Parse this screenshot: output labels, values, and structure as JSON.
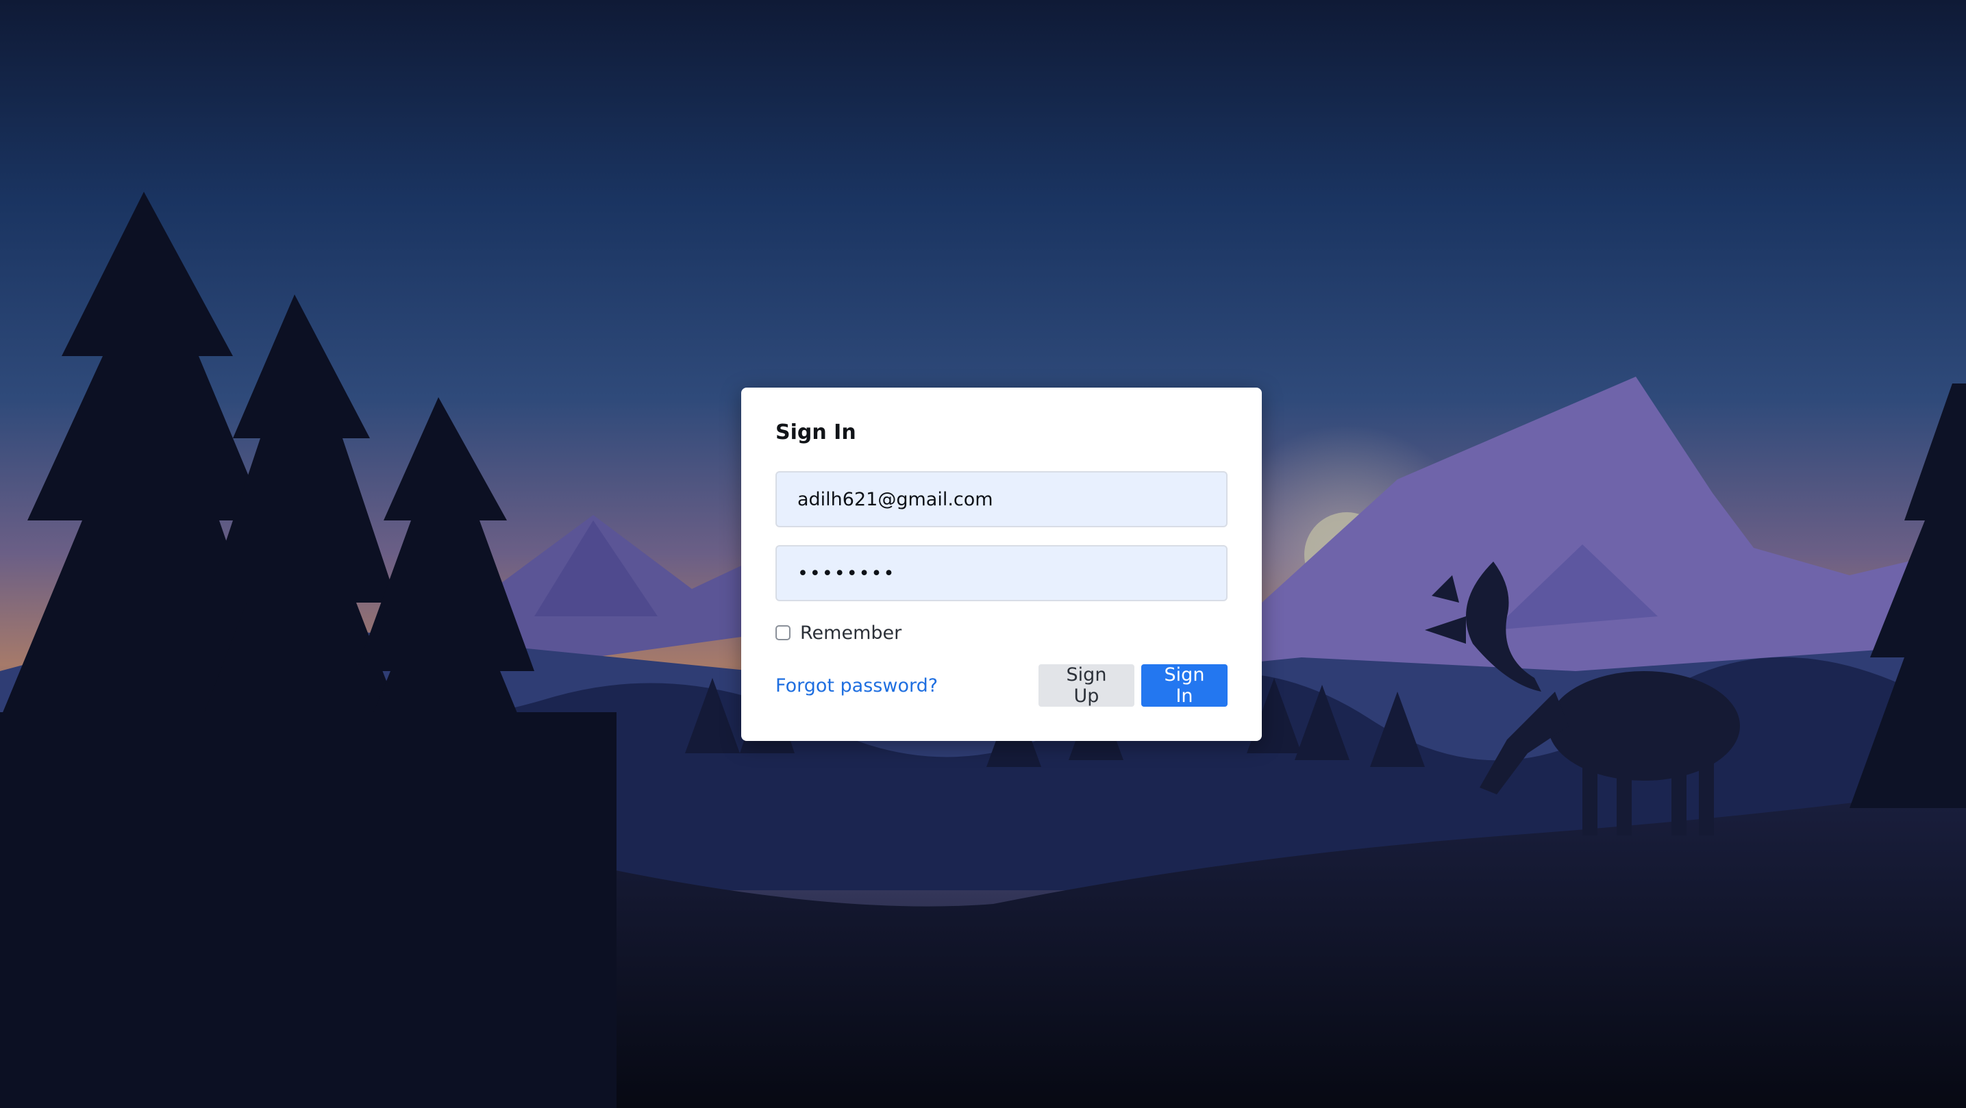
{
  "form": {
    "title": "Sign In",
    "email_value": "adilh621@gmail.com",
    "password_value": "••••••••",
    "remember_label": "Remember",
    "remember_checked": false,
    "forgot_label": "Forgot password?",
    "signup_label": "Sign Up",
    "signin_label": "Sign In"
  },
  "colors": {
    "accent": "#2377f0",
    "link": "#1f6fe0",
    "input_background": "#e8f0fe",
    "card_background": "#ffffff"
  },
  "background": {
    "scene": "mountain-forest-dusk-with-moose"
  }
}
